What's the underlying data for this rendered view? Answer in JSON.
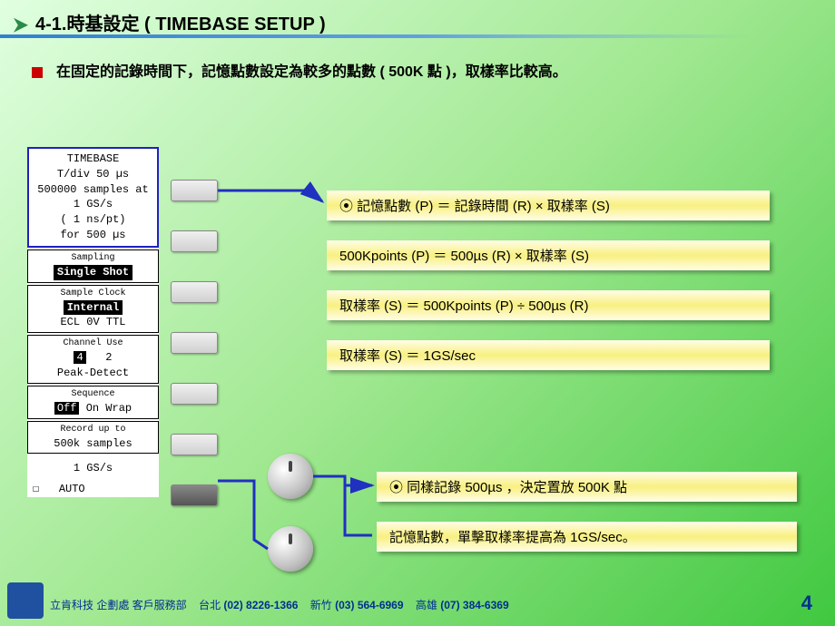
{
  "header": {
    "title": "4-1.時基設定 ( TIMEBASE SETUP )"
  },
  "bullet": {
    "text": "在固定的記錄時間下，記憶點數設定為較多的點數 ( 500K 點 )，取樣率比較高。"
  },
  "scope": {
    "title": "TIMEBASE",
    "tdiv": "T/div 50 µs",
    "samples": "500000 samples at",
    "rate": "1 GS/s",
    "nspt": "(  1 ns/pt)",
    "for": "for  500 µs",
    "sampling_lbl": "Sampling",
    "sampling_val": "Single Shot",
    "clock_lbl": "Sample Clock",
    "clock_val": "Internal",
    "clock_opts": "ECL 0V TTL",
    "chan_lbl": "Channel Use",
    "chan_sel": "4",
    "chan_alt": "2",
    "chan_mode": "Peak-Detect",
    "seq_lbl": "Sequence",
    "seq_val": "Off",
    "seq_mode": "On Wrap",
    "rec_lbl": "Record up to",
    "rec_val": "500k samples",
    "gss": "1 GS/s",
    "auto": "AUTO"
  },
  "eq": {
    "e1": "記憶點數 (P) ＝ 記錄時間 (R) × 取樣率 (S)",
    "e2": "500Kpoints (P) ＝ 500µs (R) × 取樣率 (S)",
    "e3": "取樣率 (S) ＝ 500Kpoints (P) ÷ 500µs (R)",
    "e4": "取樣率 (S) ＝ 1GS/sec",
    "e5": "同樣記錄 500µs ，決定置放 500K 點",
    "e6": "記憶點數，單擊取樣率提高為 1GS/sec。"
  },
  "footer": {
    "company": "立肯科技 企劃處 客戶服務部",
    "c1": "台北",
    "p1": "(02) 8226-1366",
    "c2": "新竹",
    "p2": "(03) 564-6969",
    "c3": "高雄",
    "p3": "(07) 384-6369",
    "page": "4"
  }
}
